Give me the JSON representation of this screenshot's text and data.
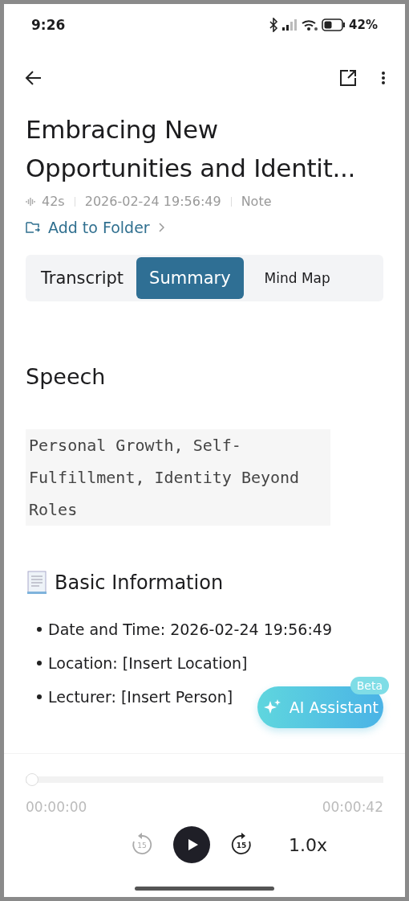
{
  "status_bar": {
    "time": "9:26",
    "battery": "42%"
  },
  "title": "Embracing New Opportunities and Identit...",
  "meta": [
    "42s",
    "2026-02-24 19:56:49",
    "Note"
  ],
  "folder_link": "Add to Folder",
  "tabs": [
    {
      "label": "Transcript",
      "selected": false
    },
    {
      "label": "Summary",
      "selected": true
    },
    {
      "label": "Mind Map",
      "selected": false
    }
  ],
  "summary": {
    "heading": "Speech",
    "keywords": "Personal Growth, Self-Fulfillment, Identity Beyond Roles",
    "section": {
      "title": "Basic Information",
      "items": [
        "Date and Time: 2026-02-24 19:56:49",
        "Location: [Insert Location]",
        "Lecturer: [Insert Person]"
      ]
    }
  },
  "ai_assistant": {
    "label": "AI Assistant",
    "badge": "Beta"
  },
  "player": {
    "level": 0,
    "elapsed": "00:00:00",
    "total": "00:00:42",
    "skip_back": {
      "label": "15",
      "disabled": true
    },
    "skip_forward": {
      "label": "15",
      "disabled": false
    },
    "speed": "1.0x"
  }
}
